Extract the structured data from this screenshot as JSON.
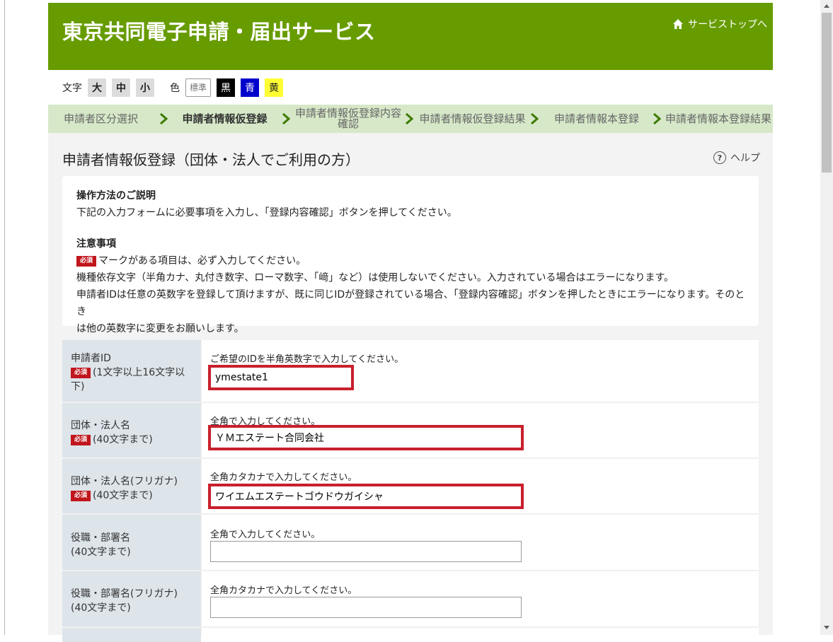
{
  "header": {
    "title": "東京共同電子申請・届出サービス",
    "top_link": "サービストップへ",
    "accent": "#679c00"
  },
  "controls": {
    "font_label": "文字",
    "font_sizes": [
      "大",
      "中",
      "小"
    ],
    "color_label": "色",
    "colors": [
      "標準",
      "黒",
      "青",
      "黄"
    ]
  },
  "breadcrumb": {
    "steps": [
      "申請者区分選択",
      "申請者情報仮登録",
      "申請者情報仮登録内容確認",
      "申請者情報仮登録結果",
      "申請者情報本登録",
      "申請者情報本登録結果"
    ],
    "active_index": 1
  },
  "page": {
    "title": "申請者情報仮登録（団体・法人でご利用の方）",
    "help": "ヘルプ"
  },
  "notice": {
    "how_title": "操作方法のご説明",
    "how_text": "下記の入力フォームに必要事項を入力し、「登録内容確認」ボタンを押してください。",
    "caution_title": "注意事項",
    "required_mark": "必須",
    "line1": "マークがある項目は、必ず入力してください。",
    "line2": "機種依存文字（半角カナ、丸付き数字、ローマ数字、「﨑」など）は使用しないでください。入力されている場合はエラーになります。",
    "line3a": "申請者IDは任意の英数字を登録して頂けますが、既に同じIDが登録されている場合、「登録内容確認」ボタンを押したときにエラーになります。そのとき",
    "line3b": "は他の英数字に変更をお願いします。"
  },
  "form": {
    "required_mark": "必須",
    "fields": [
      {
        "label": "申請者ID",
        "note1": "(1文字以上16文字以",
        "note2": "下)",
        "hint": "ご希望のIDを半角英数字で入力してください。",
        "value": "ymestate1"
      },
      {
        "label": "団体・法人名",
        "note1": "(40文字まで)",
        "hint": "全角で入力してください。",
        "value": "ＹＭエステート合同会社"
      },
      {
        "label": "団体・法人名(フリガナ)",
        "note1": "(40文字まで)",
        "hint": "全角カタカナで入力してください。",
        "value": "ワイエムエステートゴウドウガイシャ"
      },
      {
        "label": "役職・部署名",
        "note1": "(40文字まで)",
        "hint": "全角で入力してください。",
        "value": ""
      },
      {
        "label": "役職・部署名(フリガナ)",
        "note1": "(40文字まで)",
        "hint": "全角カタカナで入力してください。",
        "value": ""
      }
    ]
  },
  "highlight_color": "#c8202c"
}
